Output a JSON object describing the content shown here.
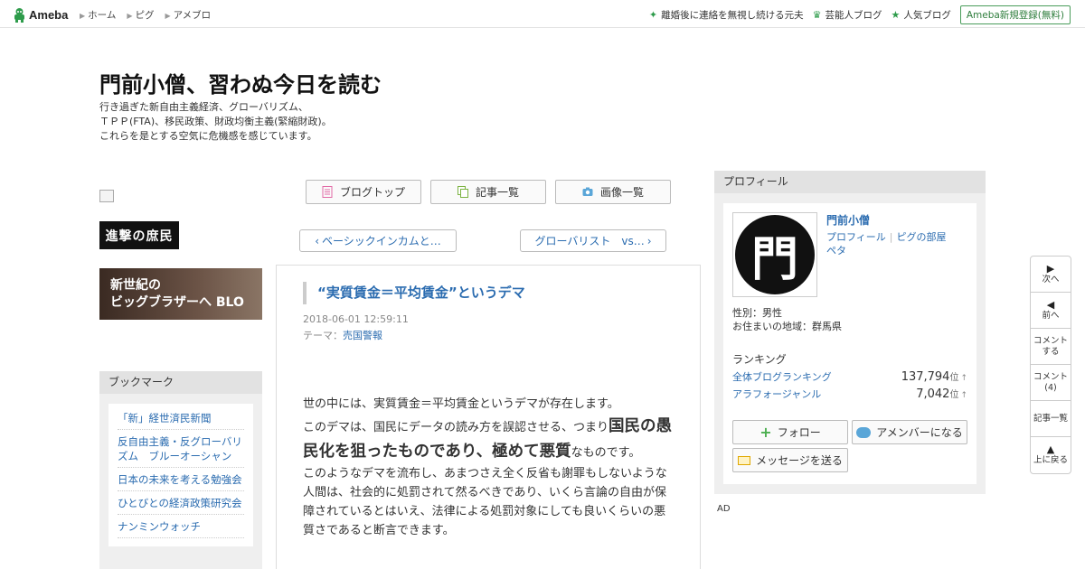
{
  "topbar": {
    "logo": "Ameba",
    "nav": [
      "ホーム",
      "ピグ",
      "アメブロ"
    ],
    "right_links": [
      {
        "label": "離婚後に連絡を無視し続ける元夫",
        "icon": "sparkle-icon"
      },
      {
        "label": "芸能人ブログ",
        "icon": "crown-icon"
      },
      {
        "label": "人気ブログ",
        "icon": "star-icon"
      }
    ],
    "register": "Ameba新規登録(無料)"
  },
  "header": {
    "title": "門前小僧、習わぬ今日を読む",
    "desc": [
      "行き過ぎた新自由主義経済、グローバリズム、",
      "ＴＰＰ(FTA)、移民政策、財政均衡主義(緊縮財政)。",
      "これらを是とする空気に危機感を感じています。"
    ]
  },
  "sidebar": {
    "banner1": "進撃の庶民",
    "banner2_lines": [
      "新世紀の",
      "ビッグブラザーへ BLO"
    ],
    "bookmark_title": "ブックマーク",
    "bookmarks": [
      "「新」経世済民新聞",
      "反自由主義・反グローバリズム　ブルーオーシャン",
      "日本の未来を考える勉強会",
      "ひとびとの経済政策研究会",
      "ナンミンウォッチ"
    ]
  },
  "tabs": [
    "ブログトップ",
    "記事一覧",
    "画像一覧"
  ],
  "pager": {
    "prev": "ベーシックインカムと…",
    "next": "グローバリスト　vs…"
  },
  "entry": {
    "title": "“実質賃金＝平均賃金”というデマ",
    "date": "2018-06-01 12:59:11",
    "theme_label": "テーマ：",
    "theme": "売国警報",
    "p1": "世の中には、実質賃金＝平均賃金というデマが存在します。",
    "p2a": "このデマは、国民にデータの読み方を誤認させる、つまり",
    "p2b": "国民の愚民化を狙ったものであり、極めて悪質",
    "p2c": "なものです。",
    "p3": "このようなデマを流布し、あまつさえ全く反省も謝罪もしないような人間は、社会的に処罰されて然るべきであり、いくら言論の自由が保障されているとはいえ、法律による処罰対象にしても良いくらいの悪質さであると断言できます。"
  },
  "profile": {
    "title": "プロフィール",
    "avatar_glyph": "門",
    "name": "門前小僧",
    "link1": "プロフィール",
    "link2": "ピグの部屋",
    "link3": "ペタ",
    "gender": "性別：男性",
    "area": "お住まいの地域：群馬県",
    "ranking_title": "ランキング",
    "rank1_label": "全体ブログランキング",
    "rank1_value": "137,794",
    "rank2_label": "アラフォージャンル",
    "rank2_value": "7,042",
    "rank_unit": "位",
    "rank_up": "↑",
    "follow": "フォロー",
    "member": "アメンバーになる",
    "message": "メッセージを送る"
  },
  "ad": "AD",
  "sidenav": {
    "next": "次へ",
    "prev": "前へ",
    "comment_1": "コメント",
    "comment_2": "する",
    "comments_1": "コメント",
    "comments_2": "(4)",
    "list": "記事一覧",
    "top": "上に戻る"
  },
  "colors": {
    "accent": "#2b6cb0",
    "ameba_green": "#2e9c4b"
  }
}
